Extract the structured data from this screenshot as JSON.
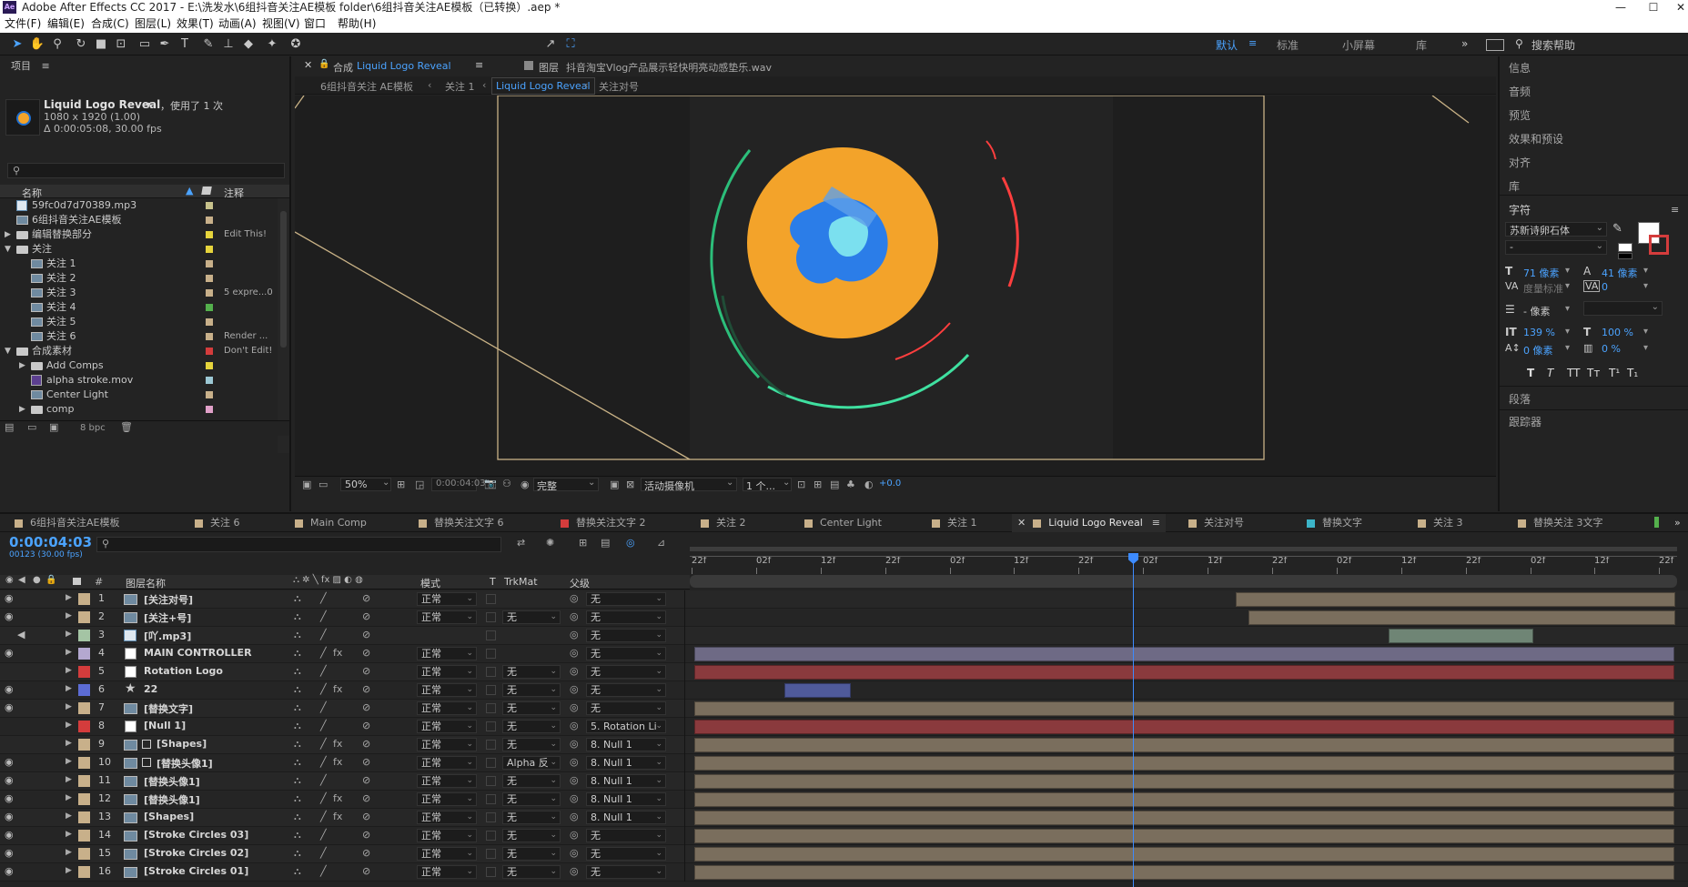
{
  "window": {
    "title": "Adobe After Effects CC 2017 - E:\\洗发水\\6组抖音关注AE模板 folder\\6组抖音关注AE模板（已转换）.aep *",
    "app_badge": "Ae",
    "min": "—",
    "max": "☐",
    "close": "✕"
  },
  "menu": [
    "文件(F)",
    "编辑(E)",
    "合成(C)",
    "图层(L)",
    "效果(T)",
    "动画(A)",
    "视图(V)",
    "窗口",
    "帮助(H)"
  ],
  "toolbar": {
    "align_label": "对齐",
    "workspaces": [
      "默认",
      "标准",
      "小屏幕",
      "库"
    ],
    "search_placeholder": "搜索帮助",
    "more": "»"
  },
  "project": {
    "title": "项目",
    "comp_name": "Liquid Logo Reveal",
    "used": "，使用了 1 次",
    "dims": "1080 x 1920 (1.00)",
    "duration": "Δ 0:00:05:08, 30.00 fps",
    "search_icon": "search-icon",
    "headers": {
      "name": "名称",
      "comment": "注释"
    },
    "items": [
      {
        "name": "59fc0d7d70389.mp3",
        "comment": "",
        "color": "#c8c28c",
        "indent": 0,
        "type": "audio",
        "expand": ""
      },
      {
        "name": "6组抖音关注AE模板",
        "comment": "",
        "color": "#c8b08a",
        "indent": 0,
        "type": "comp",
        "expand": ""
      },
      {
        "name": "编辑替换部分",
        "comment": "Edit This!",
        "color": "#e6d43c",
        "indent": 0,
        "type": "folder",
        "expand": "▶"
      },
      {
        "name": "关注",
        "comment": "",
        "color": "#e6d43c",
        "indent": 0,
        "type": "folder",
        "expand": "▼"
      },
      {
        "name": "关注 1",
        "comment": "",
        "color": "#c8b08a",
        "indent": 1,
        "type": "comp",
        "expand": ""
      },
      {
        "name": "关注 2",
        "comment": "",
        "color": "#c8b08a",
        "indent": 1,
        "type": "comp",
        "expand": ""
      },
      {
        "name": "关注 3",
        "comment": "5 expre...0",
        "color": "#c8b08a",
        "indent": 1,
        "type": "comp",
        "expand": ""
      },
      {
        "name": "关注 4",
        "comment": "",
        "color": "#54b04c",
        "indent": 1,
        "type": "comp",
        "expand": ""
      },
      {
        "name": "关注 5",
        "comment": "",
        "color": "#c8b08a",
        "indent": 1,
        "type": "comp",
        "expand": ""
      },
      {
        "name": "关注 6",
        "comment": "Render ...",
        "color": "#c8b08a",
        "indent": 1,
        "type": "comp",
        "expand": ""
      },
      {
        "name": "合成素材",
        "comment": "Don't Edit!",
        "color": "#d43c3c",
        "indent": 0,
        "type": "folder",
        "expand": "▼"
      },
      {
        "name": "Add Comps",
        "comment": "",
        "color": "#e6d43c",
        "indent": 1,
        "type": "folder",
        "expand": "▶"
      },
      {
        "name": "alpha stroke.mov",
        "comment": "",
        "color": "#9cc8d4",
        "indent": 1,
        "type": "video",
        "expand": ""
      },
      {
        "name": "Center Light",
        "comment": "",
        "color": "#c8b08a",
        "indent": 1,
        "type": "comp",
        "expand": ""
      },
      {
        "name": "comp",
        "comment": "",
        "color": "#e0a0c8",
        "indent": 1,
        "type": "folder",
        "expand": "▶"
      }
    ],
    "bpc": "8 bpc"
  },
  "viewer": {
    "tab_comp_prefix": "合成",
    "tab_comp": "Liquid Logo Reveal",
    "tab_layer_prefix": "图层",
    "tab_layer": "抖音淘宝Vlog产品展示轻快明亮动感垫乐.wav",
    "breadcrumbs": [
      "6组抖音关注 AE模板",
      "关注 1",
      "Liquid Logo Reveal",
      "关注对号"
    ],
    "zoom": "50%",
    "time": "0:00:04:03",
    "quality": "完整",
    "camera": "活动摄像机",
    "views": "1 个...",
    "exposure": "+0.0"
  },
  "right_panel": {
    "items": [
      "信息",
      "音频",
      "预览",
      "效果和预设",
      "对齐",
      "库"
    ],
    "char_title": "字符",
    "font": "苏新诗卵石体",
    "style": "-",
    "size": "71 像素",
    "leading": "41 像素",
    "kerning": "度量标准",
    "tracking": "0",
    "stroke": "- 像素",
    "vscale": "139 %",
    "hscale": "100 %",
    "baseline": "0 像素",
    "tsume": "0 %",
    "styles": [
      "T",
      "T",
      "TT",
      "Tт",
      "T¹",
      "T₁"
    ],
    "para": "段落",
    "tracker": "跟踪器",
    "menu": "≡"
  },
  "tabs": [
    {
      "label": "6组抖音关注AE模板",
      "color": "#c8b08a"
    },
    {
      "label": "关注 6",
      "color": "#c8b08a"
    },
    {
      "label": "Main Comp",
      "color": "#c8b08a"
    },
    {
      "label": "替换关注文字 6",
      "color": "#c8b08a"
    },
    {
      "label": "替换关注文字 2",
      "color": "#d43c3c"
    },
    {
      "label": "关注 2",
      "color": "#c8b08a"
    },
    {
      "label": "Center Light",
      "color": "#c8b08a"
    },
    {
      "label": "关注 1",
      "color": "#c8b08a"
    },
    {
      "label": "Liquid Logo Reveal",
      "color": "#c8b08a",
      "active": true
    },
    {
      "label": "关注对号",
      "color": "#c8b08a"
    },
    {
      "label": "替换文字",
      "color": "#3cb4c8"
    },
    {
      "label": "关注 3",
      "color": "#c8b08a"
    },
    {
      "label": "替换关注 3文字",
      "color": "#c8b08a"
    }
  ],
  "timeline": {
    "current_time": "0:00:04:03",
    "frame_info": "00123 (30.00 fps)",
    "headers": {
      "num": "#",
      "name": "图层名称",
      "mode": "模式",
      "t": "T",
      "trkmat": "TrkMat",
      "parent": "父级"
    },
    "ruler": [
      "22f",
      "02f",
      "12f",
      "22f",
      "02f",
      "12f",
      "22f",
      "02f",
      "12f",
      "22f",
      "02f",
      "12f",
      "22f",
      "02f",
      "12f",
      "22f"
    ],
    "layers": [
      {
        "num": "1",
        "name": "[关注对号]",
        "color": "#c8b08a",
        "mode": "正常",
        "trk": "",
        "parent": "无",
        "icon": "comp",
        "bar": "#7a6e5d",
        "bar_start": 0.553,
        "bar_end": 0.998,
        "eye": true,
        "fx": false
      },
      {
        "num": "2",
        "name": "[关注+号]",
        "color": "#c8b08a",
        "mode": "正常",
        "trk": "无",
        "parent": "无",
        "icon": "comp",
        "bar": "#7a6e5d",
        "bar_start": 0.566,
        "bar_end": 0.998,
        "eye": true,
        "fx": false
      },
      {
        "num": "3",
        "name": "[吖.mp3]",
        "color": "#a4c4a4",
        "mode": "",
        "trk": "",
        "parent": "无",
        "icon": "audio",
        "bar": "#6f8575",
        "bar_start": 0.708,
        "bar_end": 0.855,
        "eye": false,
        "fx": false
      },
      {
        "num": "4",
        "name": "MAIN CONTROLLER",
        "color": "#b4a8d0",
        "mode": "正常",
        "trk": "",
        "parent": "无",
        "icon": "solid",
        "bar": "#6e6a85",
        "bar_start": 0.005,
        "bar_end": 0.998,
        "eye": true,
        "fx": true
      },
      {
        "num": "5",
        "name": "Rotation Logo",
        "color": "#d43c3c",
        "mode": "正常",
        "trk": "无",
        "parent": "无",
        "icon": "solid",
        "bar": "#8a3a3d",
        "bar_start": 0.005,
        "bar_end": 0.998,
        "eye": false,
        "fx": false
      },
      {
        "num": "6",
        "name": "22",
        "color": "#5c6cd4",
        "mode": "正常",
        "trk": "无",
        "parent": "无",
        "icon": "star",
        "bar": "#4f5a9a",
        "bar_start": 0.096,
        "bar_end": 0.163,
        "eye": true,
        "fx": true
      },
      {
        "num": "7",
        "name": "[替换文字]",
        "color": "#c8b08a",
        "mode": "正常",
        "trk": "无",
        "parent": "无",
        "icon": "comp",
        "bar": "#7a6e5d",
        "bar_start": 0.005,
        "bar_end": 0.998,
        "eye": true,
        "fx": false
      },
      {
        "num": "8",
        "name": "[Null 1]",
        "color": "#d43c3c",
        "mode": "正常",
        "trk": "无",
        "parent": "5. Rotation Li",
        "icon": "solid",
        "bar": "#8a3a3d",
        "bar_start": 0.005,
        "bar_end": 0.998,
        "eye": false,
        "fx": false
      },
      {
        "num": "9",
        "name": "[Shapes]",
        "color": "#c8b08a",
        "mode": "正常",
        "trk": "无",
        "parent": "8. Null 1",
        "icon": "comp2",
        "bar": "#7a6e5d",
        "bar_start": 0.005,
        "bar_end": 0.998,
        "eye": false,
        "fx": true
      },
      {
        "num": "10",
        "name": "[替换头像1]",
        "color": "#c8b08a",
        "mode": "正常",
        "trk": "Alpha 反",
        "parent": "8. Null 1",
        "icon": "comp2",
        "bar": "#7a6e5d",
        "bar_start": 0.005,
        "bar_end": 0.998,
        "eye": true,
        "fx": true
      },
      {
        "num": "11",
        "name": "[替换头像1]",
        "color": "#c8b08a",
        "mode": "正常",
        "trk": "无",
        "parent": "8. Null 1",
        "icon": "comp",
        "bar": "#7a6e5d",
        "bar_start": 0.005,
        "bar_end": 0.998,
        "eye": true,
        "fx": false
      },
      {
        "num": "12",
        "name": "[替换头像1]",
        "color": "#c8b08a",
        "mode": "正常",
        "trk": "无",
        "parent": "8. Null 1",
        "icon": "comp",
        "bar": "#7a6e5d",
        "bar_start": 0.005,
        "bar_end": 0.998,
        "eye": true,
        "fx": true
      },
      {
        "num": "13",
        "name": "[Shapes]",
        "color": "#c8b08a",
        "mode": "正常",
        "trk": "无",
        "parent": "8. Null 1",
        "icon": "comp",
        "bar": "#7a6e5d",
        "bar_start": 0.005,
        "bar_end": 0.998,
        "eye": true,
        "fx": true
      },
      {
        "num": "14",
        "name": "[Stroke Circles 03]",
        "color": "#c8b08a",
        "mode": "正常",
        "trk": "无",
        "parent": "无",
        "icon": "comp",
        "bar": "#7a6e5d",
        "bar_start": 0.005,
        "bar_end": 0.998,
        "eye": true,
        "fx": false
      },
      {
        "num": "15",
        "name": "[Stroke Circles 02]",
        "color": "#c8b08a",
        "mode": "正常",
        "trk": "无",
        "parent": "无",
        "icon": "comp",
        "bar": "#7a6e5d",
        "bar_start": 0.005,
        "bar_end": 0.998,
        "eye": true,
        "fx": false
      },
      {
        "num": "16",
        "name": "[Stroke Circles 01]",
        "color": "#c8b08a",
        "mode": "正常",
        "trk": "无",
        "parent": "无",
        "icon": "comp",
        "bar": "#7a6e5d",
        "bar_start": 0.005,
        "bar_end": 0.998,
        "eye": true,
        "fx": false
      }
    ],
    "playhead": 0.449
  }
}
